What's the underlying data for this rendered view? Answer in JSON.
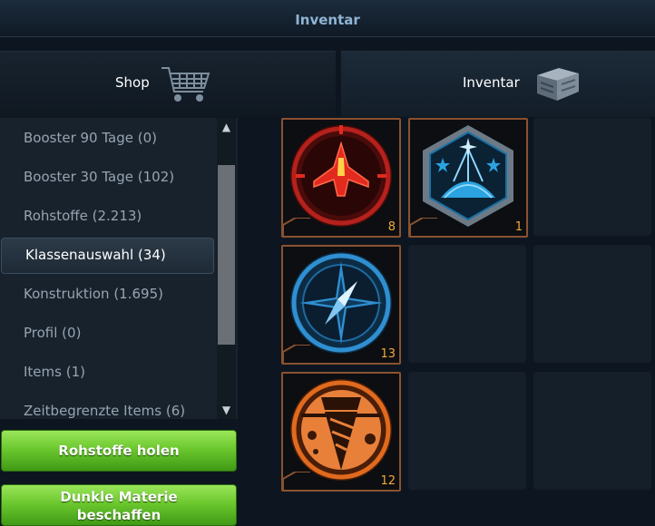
{
  "window": {
    "title": "Inventar"
  },
  "tabs": [
    {
      "label": "Shop",
      "icon": "shopping-cart-icon"
    },
    {
      "label": "Inventar",
      "icon": "crate-icon"
    }
  ],
  "categories": [
    {
      "label": "Booster 90 Tage (0)",
      "active": false
    },
    {
      "label": "Booster 30 Tage (102)",
      "active": false
    },
    {
      "label": "Rohstoffe (2.213)",
      "active": false
    },
    {
      "label": "Klassenauswahl (34)",
      "active": true
    },
    {
      "label": "Konstruktion (1.695)",
      "active": false
    },
    {
      "label": "Profil (0)",
      "active": false
    },
    {
      "label": "Items (1)",
      "active": false
    },
    {
      "label": "Zeitbegrenzte Items (6)",
      "active": false
    }
  ],
  "buttons": {
    "get_resources": "Rohstoffe holen",
    "dark_matter_line1": "Dunkle Materie",
    "dark_matter_line2": "beschaffen"
  },
  "items": [
    {
      "icon": "red-fighter-ship-icon",
      "count": "8"
    },
    {
      "icon": "blue-shield-dome-icon",
      "count": "1"
    },
    {
      "icon": "compass-icon",
      "count": "13"
    },
    {
      "icon": "drill-icon",
      "count": "12"
    }
  ],
  "colors": {
    "accent_green": "#6cc82e",
    "count_orange": "#f2a83a",
    "slot_border": "#8a5230",
    "title_blue": "#8fb4d4"
  }
}
